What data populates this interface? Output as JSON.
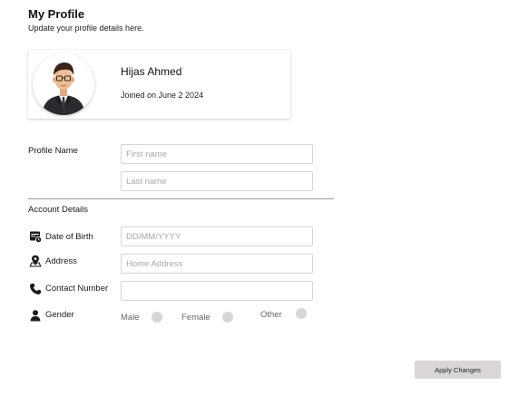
{
  "header": {
    "title": "My Profile",
    "subtitle": "Update your profile details here."
  },
  "profile_card": {
    "name": "Hijas Ahmed",
    "joined": "Joined on June 2 2024",
    "avatar_icon": "avatar-man-suit"
  },
  "profile_name": {
    "label": "Profile Name",
    "first_name": {
      "value": "",
      "placeholder": "First name"
    },
    "last_name": {
      "value": "",
      "placeholder": "Last name"
    }
  },
  "account_details": {
    "heading": "Account Details",
    "date_of_birth": {
      "label": "Date of Birth",
      "icon": "calendar-icon",
      "placeholder": "DD/MM/YYYY",
      "value": ""
    },
    "address": {
      "label": "Address",
      "icon": "map-pin-icon",
      "placeholder": "Home Address",
      "value": ""
    },
    "contact_number": {
      "label": "Contact Number",
      "icon": "phone-icon",
      "placeholder": "",
      "value": ""
    },
    "gender": {
      "label": "Gender",
      "icon": "person-icon",
      "options": [
        "Male",
        "Female",
        "Other"
      ],
      "selected": null
    }
  },
  "actions": {
    "apply_label": "Apply Changes"
  },
  "colors": {
    "radio_fill": "#d6d6d6",
    "button_bg": "#d9d6d6",
    "input_border": "#d6d6d6",
    "divider": "#9a9a9a"
  }
}
